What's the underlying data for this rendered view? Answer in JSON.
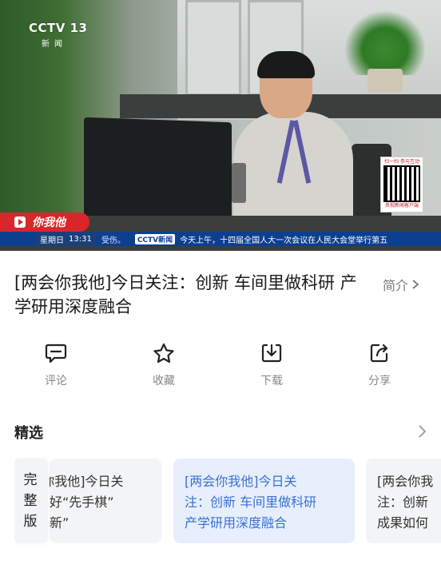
{
  "video": {
    "channel_logo": "CCTV 13",
    "channel_sub": "新闻",
    "program_tag": "你我他",
    "qr": {
      "title": "扫一扫 参与互动",
      "caption": "央视新闻客户端"
    },
    "ticker": {
      "day": "星期日",
      "time": "13:31",
      "prev": "受伤。",
      "logo": "CCTV新闻",
      "text": "今天上午，十四届全国人大一次会议在人民大会堂举行第五"
    }
  },
  "title": "[两会你我他]今日关注：创新 车间里做科研 产学研用深度融合",
  "intro_label": "简介",
  "actions": [
    {
      "label": "评论",
      "icon": "comment-icon"
    },
    {
      "label": "收藏",
      "icon": "star-icon"
    },
    {
      "label": "下载",
      "icon": "download-icon"
    },
    {
      "label": "分享",
      "icon": "share-icon"
    }
  ],
  "featured": {
    "title": "精选",
    "full_badge": "完\n整\n版",
    "cards": [
      {
        "text": "[两会你我他]今日关\n注：下好“先手棋”\n知识创新”",
        "selected": false
      },
      {
        "text": "[两会你我他]今日关\n注：创新 车间里做科研\n产学研用深度融合",
        "selected": true
      },
      {
        "text": "[两会你我\n注：创新\n成果如何",
        "selected": false
      }
    ]
  },
  "colors": {
    "accent": "#3a6fd8",
    "selected_card_bg": "#e7effd",
    "tag_red": "#d9262b",
    "ticker_blue": "#0d3f8f"
  }
}
